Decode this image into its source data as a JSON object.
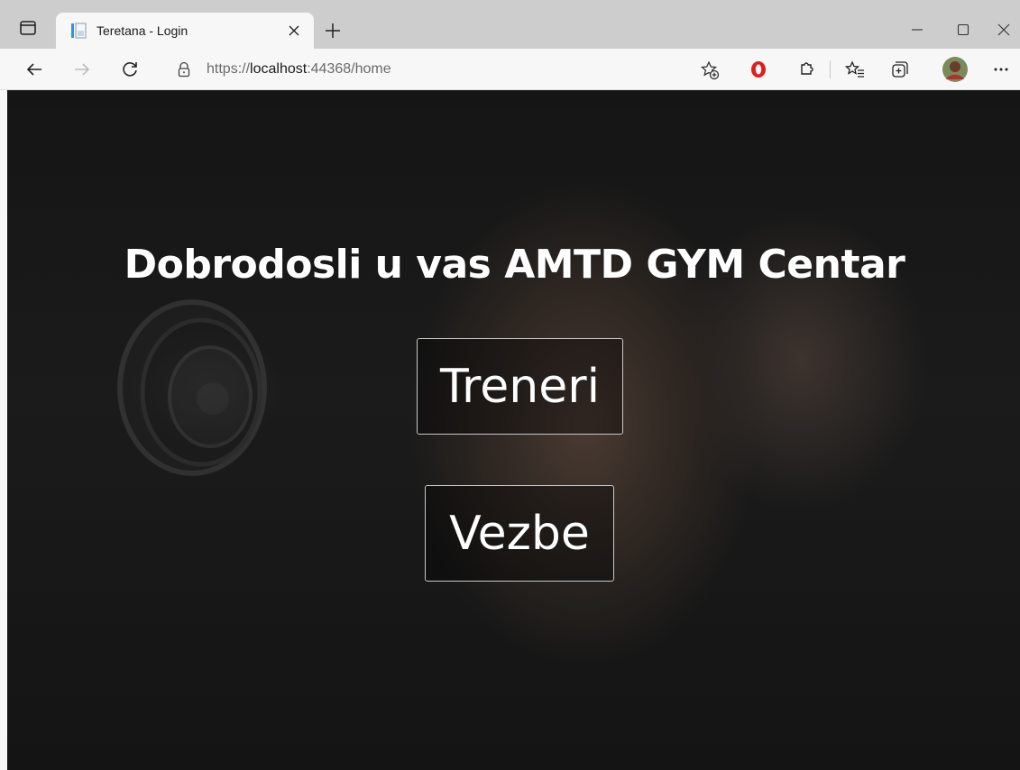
{
  "browser": {
    "tab": {
      "title": "Teretana - Login"
    },
    "address": {
      "scheme": "https://",
      "host": "localhost",
      "rest": ":44368/home"
    }
  },
  "page": {
    "heading": "Dobrodosli u vas AMTD GYM Centar",
    "buttons": {
      "treneri": "Treneri",
      "vezbe": "Vezbe"
    }
  },
  "icons": {
    "tab_actions": "tab-actions-icon",
    "favicon": "page-favicon-icon",
    "tab_close": "close-icon",
    "new_tab": "plus-icon",
    "minimize": "minimize-icon",
    "maximize": "maximize-icon",
    "close_window": "close-window-icon",
    "back": "back-arrow-icon",
    "forward": "forward-arrow-icon",
    "refresh": "refresh-icon",
    "lock": "lock-icon",
    "add_favorite": "add-favorite-icon",
    "opera": "opera-extension-icon",
    "extensions": "extensions-icon",
    "favorites": "favorites-icon",
    "collections": "collections-icon",
    "profile": "avatar",
    "more": "more-icon"
  },
  "colors": {
    "chrome_bg": "#f7f7f7",
    "tabstrip_bg": "#cdcdcd",
    "opera_red": "#e01d1d",
    "page_text": "#ffffff"
  }
}
